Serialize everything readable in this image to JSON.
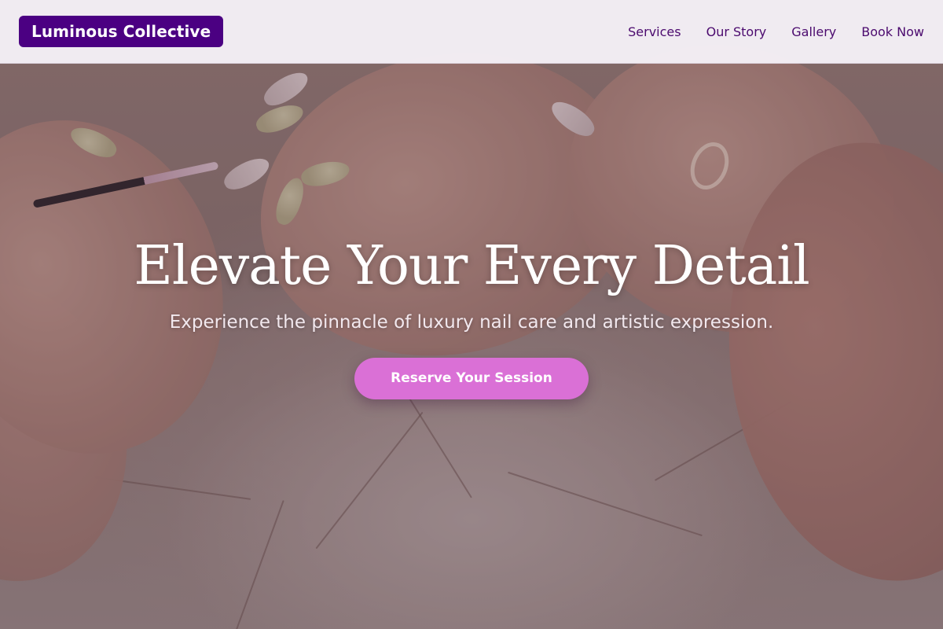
{
  "brand": {
    "name": "Luminous Collective",
    "color": "#4b0082"
  },
  "nav": {
    "items": [
      {
        "label": "Services"
      },
      {
        "label": "Our Story"
      },
      {
        "label": "Gallery"
      },
      {
        "label": "Book Now"
      }
    ],
    "link_color": "#4b0a6e"
  },
  "hero": {
    "title": "Elevate Your Every Detail",
    "subtitle": "Experience the pinnacle of luxury nail care and artistic expression.",
    "cta_label": "Reserve Your Session",
    "cta_color": "#da70d6",
    "background": "manicure-on-marble-photo"
  }
}
